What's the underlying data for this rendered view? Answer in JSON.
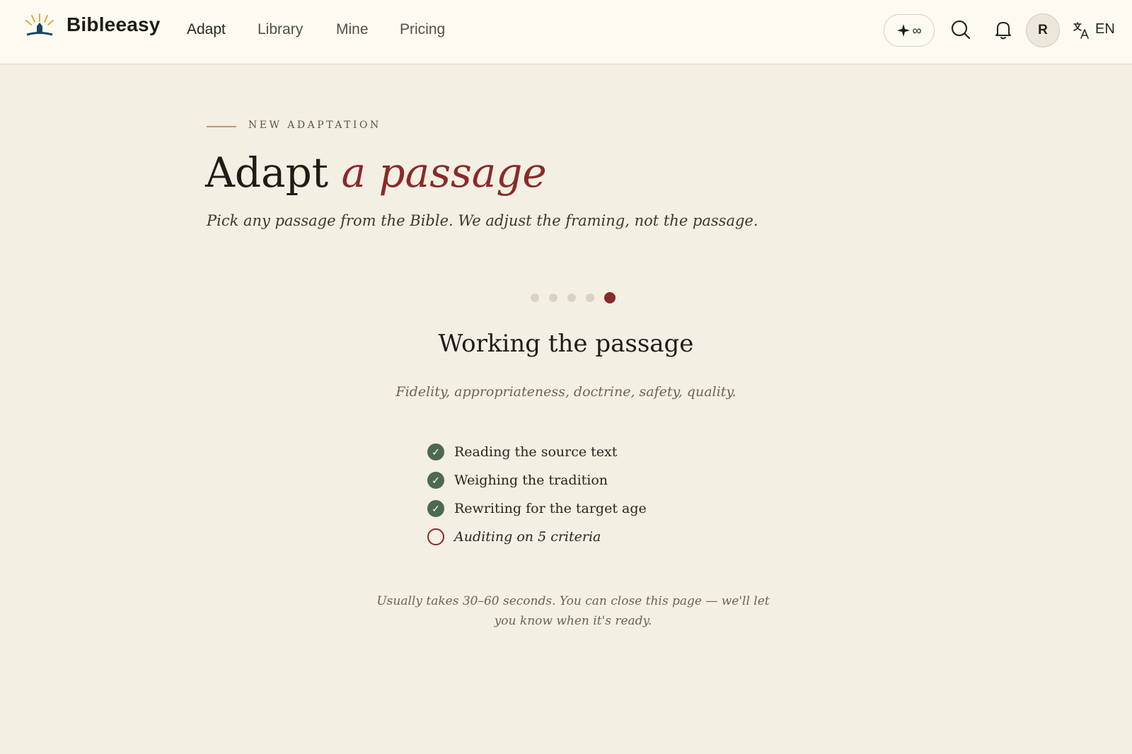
{
  "header": {
    "brand": "Bibleeasy",
    "nav": [
      "Adapt",
      "Library",
      "Mine",
      "Pricing"
    ],
    "credits_icon": "sparkle-icon",
    "credits_value": "∞",
    "avatar_initial": "R",
    "language": "EN"
  },
  "main": {
    "eyebrow": "NEW ADAPTATION",
    "title_plain": "Adapt",
    "title_accent": "a passage",
    "subtitle": "Pick any passage from the Bible. We adjust the framing, not the passage.",
    "progress": {
      "total_steps": 5,
      "current_step": 5
    },
    "step_title": "Working the passage",
    "step_subtitle": "Fidelity, appropriateness, doctrine, safety, quality.",
    "checklist": [
      {
        "label": "Reading the source text",
        "status": "done"
      },
      {
        "label": "Weighing the tradition",
        "status": "done"
      },
      {
        "label": "Rewriting for the target age",
        "status": "done"
      },
      {
        "label": "Auditing on 5 criteria",
        "status": "pending"
      }
    ],
    "footnote": "Usually takes 30–60 seconds. You can close this page — we'll let you know when it's ready."
  },
  "colors": {
    "background": "#f3efe2",
    "accent": "#8a2a2a",
    "done": "#4d6a4e"
  }
}
